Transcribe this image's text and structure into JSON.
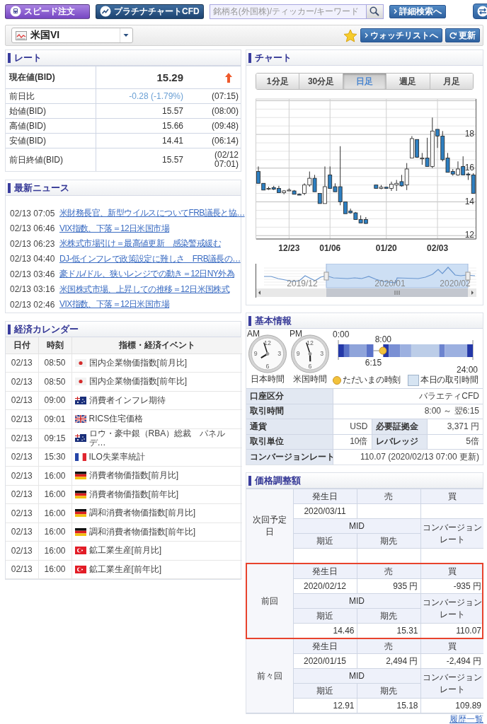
{
  "toolbar": {
    "speed_order": "スピード注文",
    "platinum_chart": "プラチナチャートCFD",
    "search": {
      "placeholder": "銘柄名(外国株)/ティッカー/キーワード"
    },
    "detail_search": "詳細検索へ"
  },
  "symbol_bar": {
    "symbol": "米国VI",
    "watchlist_button": "ウォッチリストへ",
    "refresh_button": "更新"
  },
  "rate": {
    "title": "レート",
    "rows": [
      {
        "kind": "current",
        "label": "現在値(BID)",
        "value": "15.29",
        "rising": true
      },
      {
        "kind": "change",
        "label": "前日比",
        "value": "-0.28 (-1.79%)",
        "time": "(07:15)"
      },
      {
        "kind": "plain",
        "label": "始値(BID)",
        "value": "15.57",
        "time": "(08:00)"
      },
      {
        "kind": "plain",
        "label": "高値(BID)",
        "value": "15.66",
        "time": "(09:48)"
      },
      {
        "kind": "plain",
        "label": "安値(BID)",
        "value": "14.41",
        "time": "(06:14)"
      },
      {
        "kind": "plain",
        "label": "前日終値(BID)",
        "value": "15.57",
        "time": "(02/12 07:01)"
      }
    ]
  },
  "news": {
    "title": "最新ニュース",
    "items": [
      {
        "time": "02/13 07:05",
        "headline": "米財務長官、新型ウイルスについてFRB議長と協…"
      },
      {
        "time": "02/13 06:46",
        "headline": "VIX指数、下落＝12日米国市場"
      },
      {
        "time": "02/13 06:23",
        "headline": "米株式市場引け＝最高値更新　感染警戒緩む"
      },
      {
        "time": "02/13 04:40",
        "headline": "DJ-低インフレで政策設定に難しさ　FRB議長の…"
      },
      {
        "time": "02/13 03:46",
        "headline": "豪ドル/ドル、狭いレンジでの動き＝12日NY外為"
      },
      {
        "time": "02/13 03:16",
        "headline": "米国株式市場、上昇しての推移＝12日米国株式"
      },
      {
        "time": "02/13 02:46",
        "headline": "VIX指数、下落＝12日米国市場"
      }
    ]
  },
  "calendar": {
    "title": "経済カレンダー",
    "columns": [
      "日付",
      "時刻",
      "指標・経済イベント"
    ],
    "rows": [
      {
        "date": "02/13",
        "time": "08:50",
        "kind": "jp",
        "event": "国内企業物価指数[前月比]"
      },
      {
        "date": "02/13",
        "time": "08:50",
        "kind": "jp",
        "event": "国内企業物価指数[前年比]"
      },
      {
        "date": "02/13",
        "time": "09:00",
        "kind": "au",
        "event": "消費者インフレ期待"
      },
      {
        "date": "02/13",
        "time": "09:01",
        "kind": "gb",
        "event": "RICS住宅価格"
      },
      {
        "date": "02/13",
        "time": "09:15",
        "kind": "au",
        "event": "ロウ・豪中銀（RBA）総裁　パネルデ…"
      },
      {
        "date": "02/13",
        "time": "15:30",
        "kind": "fr",
        "event": "ILO失業率統計"
      },
      {
        "date": "02/13",
        "time": "16:00",
        "kind": "de",
        "event": "消費者物価指数[前月比]"
      },
      {
        "date": "02/13",
        "time": "16:00",
        "kind": "de",
        "event": "消費者物価指数[前年比]"
      },
      {
        "date": "02/13",
        "time": "16:00",
        "kind": "de",
        "event": "調和消費者物価指数[前月比]"
      },
      {
        "date": "02/13",
        "time": "16:00",
        "kind": "de",
        "event": "調和消費者物価指数[前年比]"
      },
      {
        "date": "02/13",
        "time": "16:00",
        "kind": "tr",
        "event": "鉱工業生産[前月比]"
      },
      {
        "date": "02/13",
        "time": "16:00",
        "kind": "tr",
        "event": "鉱工業生産[前年比]"
      }
    ]
  },
  "chart": {
    "title": "チャート",
    "tabs": [
      {
        "label": "1分足",
        "selected": false
      },
      {
        "label": "30分足",
        "selected": false
      },
      {
        "label": "日足",
        "selected": true
      },
      {
        "label": "週足",
        "selected": false
      },
      {
        "label": "月足",
        "selected": false
      }
    ],
    "chart_data": {
      "type": "candlestick",
      "categories": [
        null,
        null,
        null,
        null,
        null,
        null,
        "12/23",
        null,
        null,
        null,
        null,
        null,
        null,
        null,
        "01/06",
        null,
        null,
        null,
        null,
        null,
        null,
        null,
        null,
        null,
        null,
        "01/20",
        null,
        null,
        null,
        null,
        null,
        null,
        null,
        null,
        null,
        "02/03",
        null,
        null,
        null,
        null,
        null,
        null,
        null
      ],
      "ylim": [
        11.8,
        20.1
      ],
      "grid": true,
      "ohlc": [
        [
          15.8,
          16.1,
          15.1,
          15.1
        ],
        [
          15.1,
          15.1,
          14.7,
          14.7
        ],
        [
          14.8,
          14.9,
          14.7,
          14.8
        ],
        [
          14.85,
          14.95,
          14.7,
          14.75
        ],
        [
          14.8,
          14.95,
          14.55,
          14.55
        ],
        [
          14.55,
          14.7,
          14.45,
          14.65
        ],
        [
          14.7,
          14.8,
          14.65,
          14.7
        ],
        [
          14.65,
          14.7,
          14.45,
          14.45
        ],
        [
          14.45,
          14.5,
          14.4,
          14.42
        ],
        [
          14.5,
          15.1,
          14.4,
          15.0
        ],
        [
          15.0,
          15.8,
          14.9,
          15.4
        ],
        [
          15.4,
          15.6,
          14.6,
          14.6
        ],
        [
          14.5,
          14.5,
          13.9,
          13.9
        ],
        [
          13.9,
          16.1,
          13.9,
          14.9
        ],
        [
          15.6,
          16.1,
          14.8,
          14.8
        ],
        [
          14.9,
          15.1,
          14.6,
          14.6
        ],
        [
          14.9,
          17.3,
          13.8,
          14.0
        ],
        [
          14.0,
          14.0,
          13.3,
          13.3
        ],
        [
          13.45,
          13.6,
          13.3,
          13.35
        ],
        [
          13.35,
          13.4,
          12.95,
          12.95
        ],
        [
          12.95,
          13.2,
          12.75,
          12.75
        ],
        [
          12.95,
          13.1,
          12.7,
          12.72
        ],
        null,
        [
          15.0,
          15.0,
          14.8,
          14.8
        ],
        [
          14.8,
          15.0,
          14.75,
          14.87
        ],
        [
          14.87,
          14.9,
          14.8,
          14.8
        ],
        [
          14.8,
          15.2,
          14.65,
          15.05
        ],
        [
          15.0,
          15.3,
          14.65,
          15.1
        ],
        [
          15.2,
          15.6,
          14.9,
          14.95
        ],
        [
          15.0,
          16.3,
          14.7,
          15.95
        ],
        [
          16.6,
          17.9,
          16.6,
          17.75
        ],
        [
          17.7,
          17.7,
          16.6,
          16.65
        ],
        [
          16.6,
          16.9,
          16.2,
          16.6
        ],
        [
          16.6,
          17.8,
          16.1,
          16.1
        ],
        [
          16.1,
          19.0,
          16.0,
          18.2
        ],
        [
          18.3,
          18.3,
          17.2,
          17.9
        ],
        [
          17.9,
          18.2,
          16.4,
          16.5
        ],
        [
          16.6,
          16.9,
          15.75,
          15.75
        ],
        [
          15.8,
          15.95,
          15.55,
          15.65
        ],
        [
          15.6,
          16.4,
          15.55,
          15.95
        ],
        [
          16.1,
          16.7,
          15.6,
          15.6
        ],
        [
          15.65,
          15.75,
          15.3,
          15.62
        ],
        [
          15.6,
          15.7,
          14.5,
          14.5
        ]
      ],
      "yticks": [
        18,
        16,
        14,
        12
      ]
    },
    "navigator_labels": [
      "2019/12",
      "2020/01",
      "2020/02"
    ]
  },
  "basic_info": {
    "title": "基本情報",
    "clocks": [
      {
        "period": "AM",
        "numerals": [
          "12",
          "3",
          "6",
          "9"
        ],
        "caption": "日本時間"
      },
      {
        "period": "PM",
        "numerals": [
          "12",
          "3",
          "6",
          "9"
        ],
        "caption": "米国時間"
      }
    ],
    "timeline": {
      "start": "0:00",
      "open": "8:00",
      "close": "6:15",
      "end": "24:00"
    },
    "legend": [
      "ただいまの時刻",
      "本日の取引時間"
    ],
    "rows": [
      {
        "cells": [
          {
            "label": "口座区分",
            "value": "バラエティCFD"
          }
        ]
      },
      {
        "cells": [
          {
            "label": "取引時間",
            "value": "8:00 ～ 翌6:15"
          }
        ]
      },
      {
        "cells": [
          {
            "label": "通貨",
            "value": "USD"
          },
          {
            "label": "必要証拠金",
            "value": "3,371 円"
          }
        ]
      },
      {
        "cells": [
          {
            "label": "取引単位",
            "value": "10倍"
          },
          {
            "label": "レバレッジ",
            "value": "5倍"
          }
        ]
      },
      {
        "cells": [
          {
            "label": "コンバージョンレート",
            "value": "110.07  (2020/02/13 07:00 更新)"
          }
        ]
      }
    ]
  },
  "adjustments": {
    "title": "価格調整額",
    "entries": [
      {
        "name": "次回予定日",
        "highlighted": false,
        "date_header": "発生日",
        "sell_header": "売",
        "buy_header": "買",
        "date": "2020/03/11",
        "mid_header": "MID",
        "rate_header": "コンバージョンレート",
        "near_header": "期近",
        "far_header": "期先"
      },
      {
        "name": "前回",
        "highlighted": true,
        "date_header": "発生日",
        "sell_header": "売",
        "buy_header": "買",
        "date": "2020/02/12",
        "sell": "935 円",
        "buy": "-935 円",
        "mid_header": "MID",
        "rate_header": "コンバージョンレート",
        "near_header": "期近",
        "far_header": "期先",
        "near": "14.46",
        "far": "15.31",
        "rate": "110.07"
      },
      {
        "name": "前々回",
        "highlighted": false,
        "date_header": "発生日",
        "sell_header": "売",
        "buy_header": "買",
        "date": "2020/01/15",
        "sell": "2,494 円",
        "buy": "-2,494 円",
        "mid_header": "MID",
        "rate_header": "コンバージョンレート",
        "near_header": "期近",
        "far_header": "期先",
        "near": "12.91",
        "far": "15.18",
        "rate": "109.89"
      }
    ],
    "history_link": "履歴一覧"
  }
}
